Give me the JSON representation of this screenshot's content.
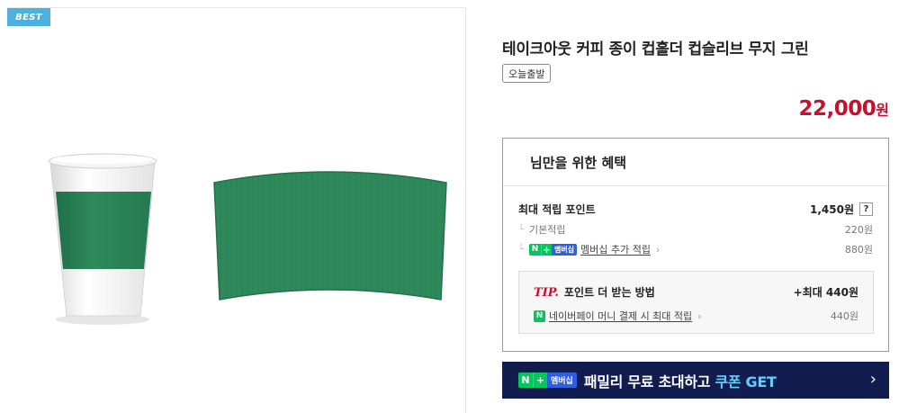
{
  "badge": {
    "best": "BEST"
  },
  "product": {
    "title": "테이크아웃 커피 종이 컵홀더 컵슬리브 무지 그린",
    "shipping_tag": "오늘출발",
    "price": "22,000",
    "price_unit": "원",
    "image_colors": {
      "sleeve": "#2e8a5b",
      "cup": "#ffffff"
    }
  },
  "benefit": {
    "header": "님만을 위한 혜택",
    "max_points_label": "최대 적립 포인트",
    "max_points_value": "1,450원",
    "help_label": "?",
    "basic_label": "기본적립",
    "basic_value": "220원",
    "member_badge": {
      "n": "N",
      "plus": "+",
      "text": "멤버십"
    },
    "member_label": "멤버십 추가 적립",
    "member_value": "880원",
    "tip": {
      "label": "TIP.",
      "title": "포인트 더 받는 방법",
      "max_text": "+최대 440원",
      "npay_icon": "N",
      "npay_text": "네이버페이 머니 결제 시 최대 적립",
      "npay_value": "440원"
    }
  },
  "family_banner": {
    "badge": {
      "n": "N",
      "plus": "+",
      "text": "멤버십"
    },
    "text_main": "패밀리 무료 초대하고 ",
    "text_accent": "쿠폰 GET",
    "chevron": "›"
  },
  "colors": {
    "price": "#c8102e",
    "best_badge": "#4db1dd",
    "banner": "#131c4f",
    "naver_green": "#03c75a"
  }
}
